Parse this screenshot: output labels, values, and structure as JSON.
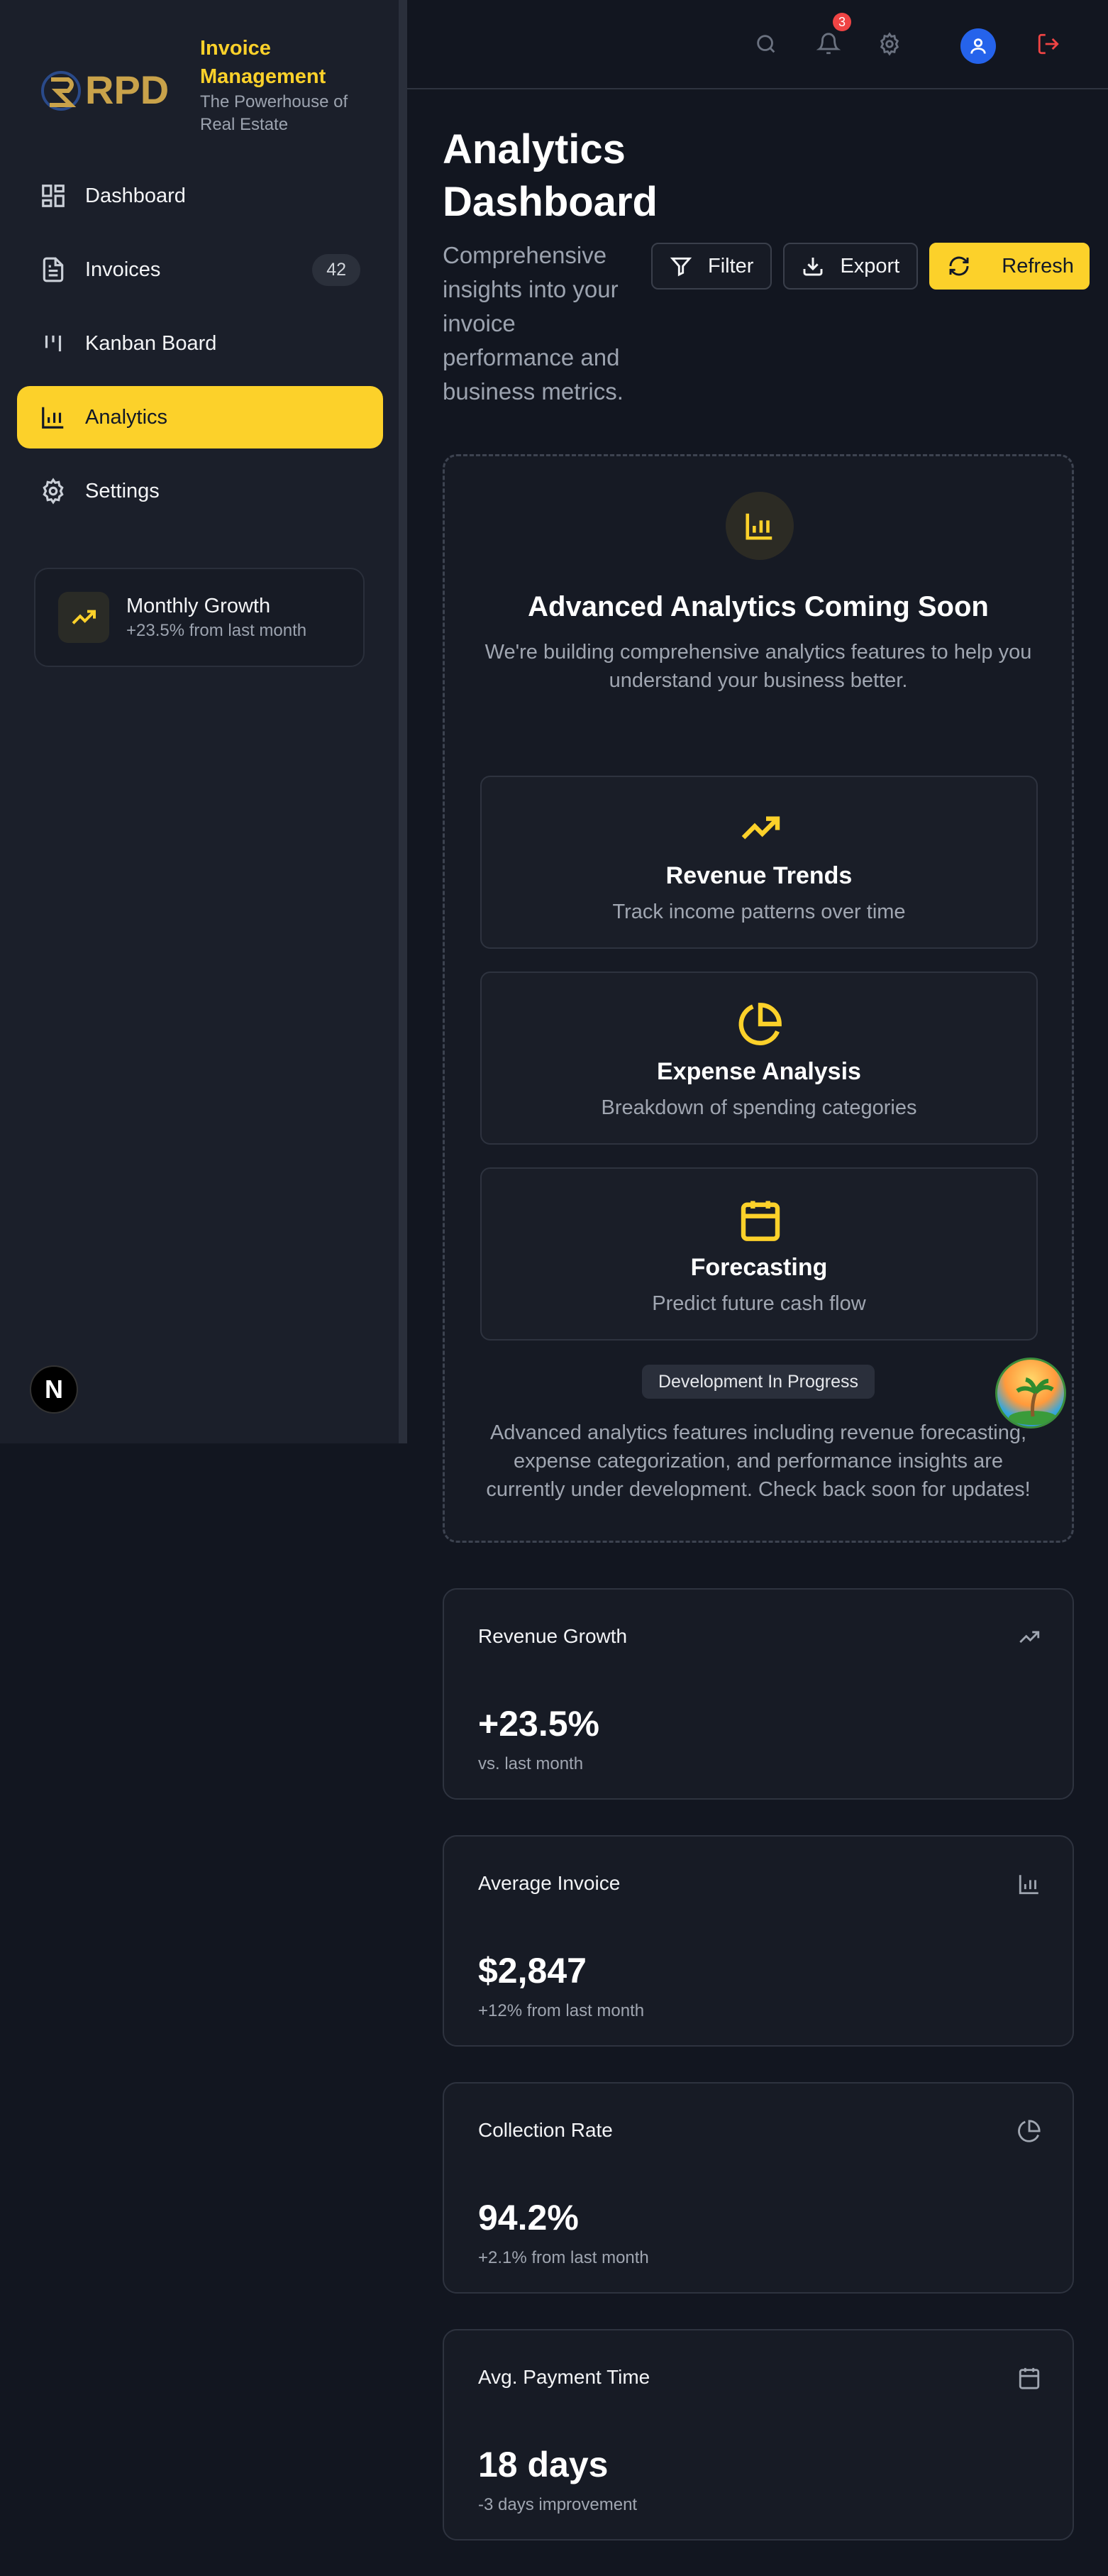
{
  "app": {
    "title": "Invoice Management",
    "subtitle": "The Powerhouse of Real Estate",
    "logo_text": "RPD"
  },
  "colors": {
    "accent": "#fcd12a",
    "background": "#121620",
    "danger": "#ef4444",
    "avatar": "#2563eb"
  },
  "sidebar": {
    "items": [
      {
        "label": "Dashboard",
        "icon": "dashboard-icon"
      },
      {
        "label": "Invoices",
        "icon": "file-icon",
        "badge": "42"
      },
      {
        "label": "Kanban Board",
        "icon": "kanban-icon"
      },
      {
        "label": "Analytics",
        "icon": "bar-chart-icon",
        "active": true
      },
      {
        "label": "Settings",
        "icon": "gear-icon"
      }
    ],
    "growth": {
      "title": "Monthly Growth",
      "subtitle": "+23.5% from last month"
    },
    "n_badge": "N"
  },
  "topbar": {
    "notification_count": "3"
  },
  "page": {
    "title": "Analytics Dashboard",
    "description": "Comprehensive insights into your invoice performance and business metrics.",
    "actions": {
      "filter": "Filter",
      "export": "Export",
      "refresh": "Refresh"
    }
  },
  "coming_soon": {
    "title": "Advanced Analytics Coming Soon",
    "description": "We're building comprehensive analytics features to help you understand your business better.",
    "features": [
      {
        "title": "Revenue Trends",
        "subtitle": "Track income patterns over time"
      },
      {
        "title": "Expense Analysis",
        "subtitle": "Breakdown of spending categories"
      },
      {
        "title": "Forecasting",
        "subtitle": "Predict future cash flow"
      }
    ],
    "badge": "Development In Progress",
    "footer": "Advanced analytics features including revenue forecasting, expense categorization, and performance insights are currently under development. Check back soon for updates!"
  },
  "stats": [
    {
      "label": "Revenue Growth",
      "value": "+23.5%",
      "sub": "vs. last month",
      "icon": "trending-up-icon"
    },
    {
      "label": "Average Invoice",
      "value": "$2,847",
      "sub": "+12% from last month",
      "icon": "bar-chart-icon"
    },
    {
      "label": "Collection Rate",
      "value": "94.2%",
      "sub": "+2.1% from last month",
      "icon": "pie-chart-icon"
    },
    {
      "label": "Avg. Payment Time",
      "value": "18 days",
      "sub": "-3 days improvement",
      "icon": "calendar-icon"
    }
  ]
}
